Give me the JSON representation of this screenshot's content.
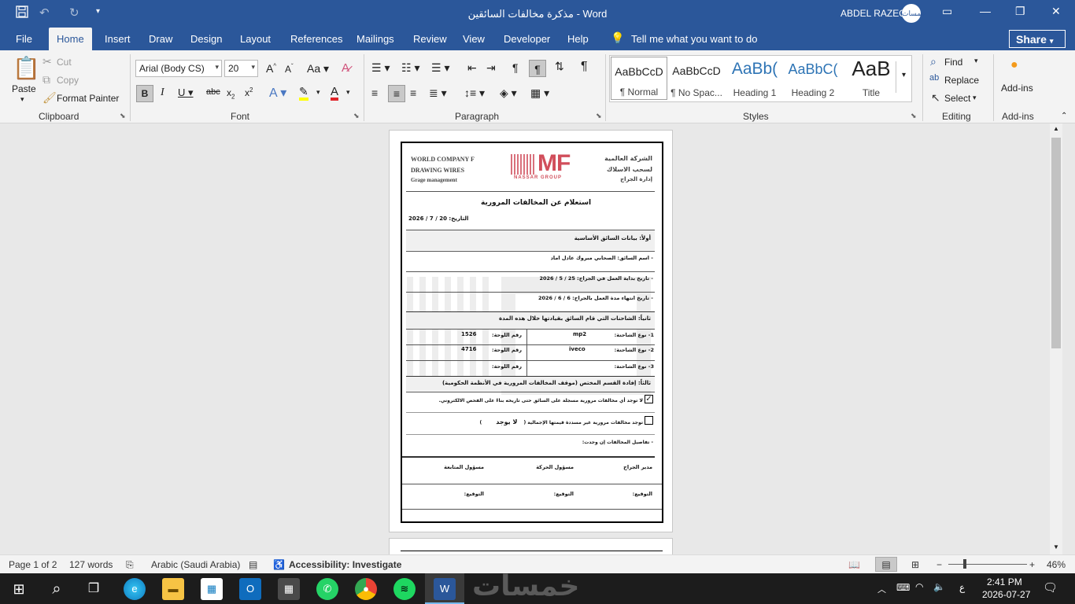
{
  "titlebar": {
    "title": "مذكرة مخالفات السائقين  -  Word",
    "user": "ABDEL RAZEQ",
    "avatar_text": "خمسات"
  },
  "tabs": [
    "File",
    "Home",
    "Insert",
    "Draw",
    "Design",
    "Layout",
    "References",
    "Mailings",
    "Review",
    "View",
    "Developer",
    "Help"
  ],
  "tell_me": "Tell me what you want to do",
  "share_label": "Share",
  "clipboard": {
    "paste": "Paste",
    "cut": "Cut",
    "copy": "Copy",
    "format_painter": "Format Painter",
    "label": "Clipboard"
  },
  "font": {
    "name": "Arial (Body CS)",
    "size": "20",
    "label": "Font"
  },
  "paragraph": {
    "label": "Paragraph"
  },
  "styles": {
    "items": [
      {
        "preview": "AaBbCcD",
        "name": "¶ Normal"
      },
      {
        "preview": "AaBbCcD",
        "name": "¶ No Spac..."
      },
      {
        "preview": "AaBb(",
        "name": "Heading 1"
      },
      {
        "preview": "AaBbC(",
        "name": "Heading 2"
      },
      {
        "preview": "AaB",
        "name": "Title"
      }
    ],
    "label": "Styles"
  },
  "editing": {
    "find": "Find",
    "replace": "Replace",
    "select": "Select",
    "label": "Editing"
  },
  "addins": {
    "button": "Add-ins",
    "label": "Add-ins"
  },
  "document": {
    "company_en": [
      "WORLD COMPANY F",
      "DRAWING WIRES",
      "Grage management"
    ],
    "company_ar": [
      "الشركة العالمية",
      "لسحب الاسلاك",
      "إدارة الجراج"
    ],
    "logo_main": "MF",
    "logo_sub": "NASSAR GROUP",
    "heading": "استعلام عن المخالفات المرورية",
    "date_line": "التاريخ:  20  / 7 / 2026",
    "section1": "أولاً: بيانات السائق الأساسية",
    "driver_name": "- اسم السائق: الصحابي مبروك عادل اماد",
    "start_date": "- تاريخ بداية العمل في الجراج:   25  / 5  / 2026",
    "end_date": "- تاريخ انتهاء مدة العمل بالجراج:   6  / 6  / 2026",
    "section2": "ثانياً: الشاحنات التي قام السائق بقيادتها خلال هذه المدة",
    "trucks": [
      {
        "type_label": "1- نوع الشاحنة:",
        "type": "mp2",
        "plate_label": "رقم اللوحة:",
        "plate": "1526"
      },
      {
        "type_label": "2- نوع الشاحنة:",
        "type": "iveco",
        "plate_label": "رقم اللوحة:",
        "plate": "4716"
      },
      {
        "type_label": "3- نوع الشاحنة:",
        "type": "",
        "plate_label": "رقم اللوحة:",
        "plate": ""
      }
    ],
    "section3": "ثالثاً: إفادة القسم المختص (موقف المخالفات المرورية في الأنظمة الحكومية)",
    "option_none": "لا توجد أي مخالفات مرورية مسجلة على السائق حتى تاريخه بناءً على الفحص الالكتروني.",
    "option_exist": "توجد مخالفات مرورية غير مسددة قيمتها الإجمالية (",
    "option_exist_value": "لا يوجد",
    "option_exist_close": ")",
    "details": "- تفاصيل المخالفات إن وجدت:",
    "signers": [
      "مدير الجراج",
      "مسؤول الحركة",
      "مسؤول المتابعة"
    ],
    "signature": "التوقيع:"
  },
  "statusbar": {
    "page": "Page 1 of 2",
    "words": "127 words",
    "language": "Arabic (Saudi Arabia)",
    "accessibility": "Accessibility: Investigate",
    "zoom": "46%"
  },
  "taskbar": {
    "time": "2:41 PM",
    "date": "2026-07-27",
    "lang": "ع",
    "watermark": "خمسات"
  },
  "colors": {
    "word_blue": "#2b579a",
    "taskbar": "#1c1c1c"
  }
}
